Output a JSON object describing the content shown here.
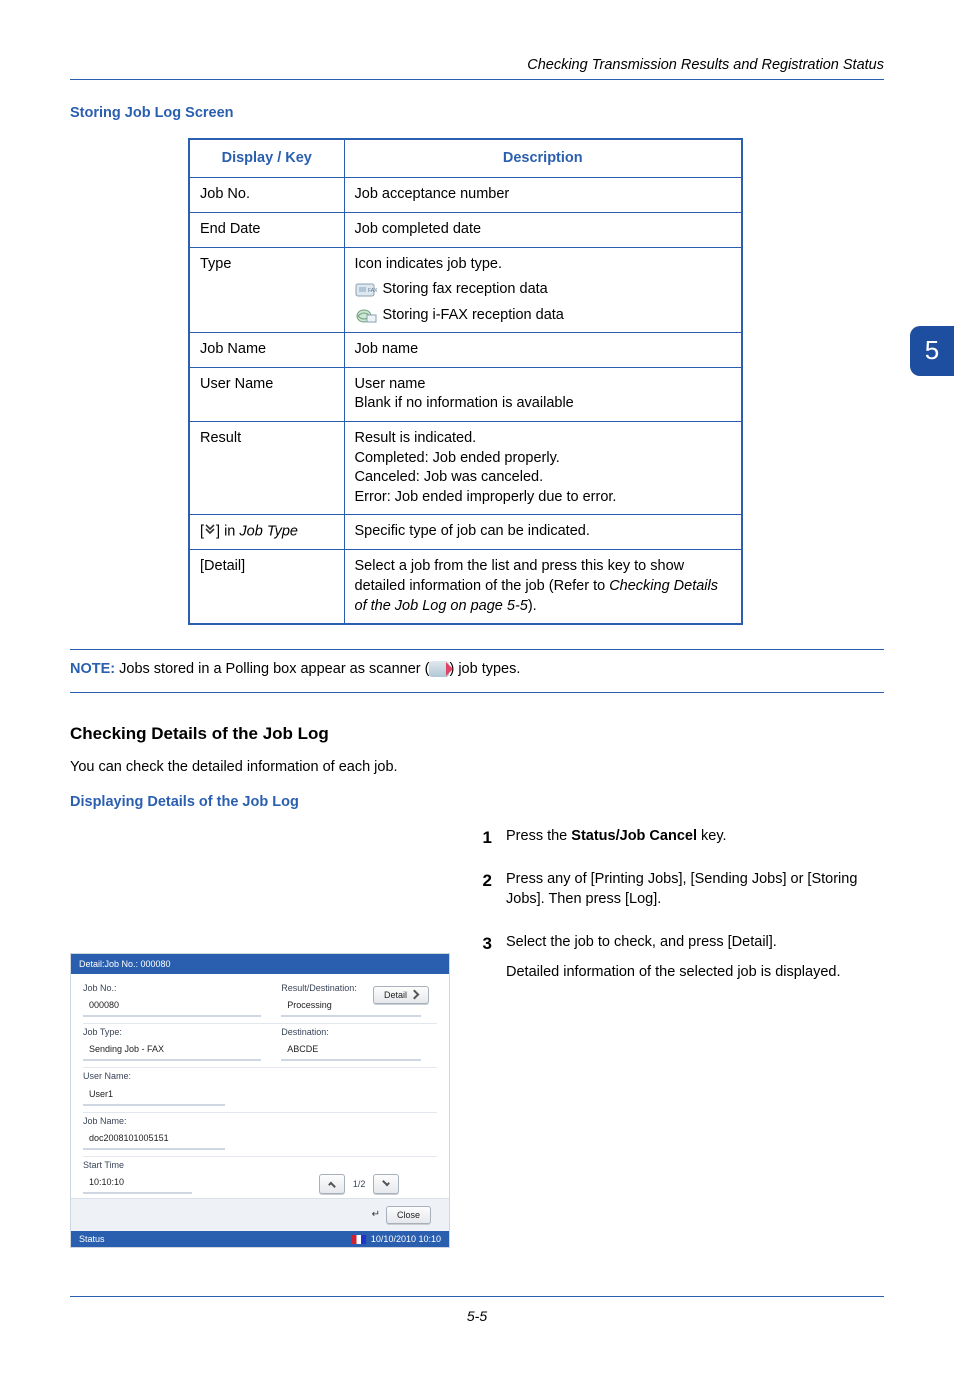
{
  "header": {
    "right": "Checking Transmission Results and Registration Status"
  },
  "section1": {
    "title": "Storing Job Log Screen"
  },
  "table": {
    "head": {
      "c1": "Display / Key",
      "c2": "Description"
    },
    "rows": [
      {
        "k": "Job No.",
        "v": "Job acceptance number"
      },
      {
        "k": "End Date",
        "v": "Job completed date"
      },
      {
        "k": "Type",
        "v_lines": {
          "l1": "Icon indicates job type.",
          "l2": " Storing fax reception data",
          "l3": "Storing i-FAX reception data"
        }
      },
      {
        "k": "Job Name",
        "v": "Job name"
      },
      {
        "k": "User Name",
        "v": "User name\nBlank if no information is available"
      },
      {
        "k": "Result",
        "v": "Result is indicated.\nCompleted: Job ended properly.\nCanceled: Job was canceled.\nError: Job ended improperly due to error."
      },
      {
        "k": "[     ] in Job Type",
        "k_icon_note": "down-chevrons",
        "v": "Specific type of job can be indicated."
      },
      {
        "k": "[Detail]",
        "v": "Select a job from the list and press this key to show detailed information of the job (Refer to Checking Details of the Job Log on page 5-5)."
      }
    ]
  },
  "note": {
    "label": "NOTE:",
    "text_before": " Jobs stored in a Polling box appear as scanner (",
    "text_after": ") job types."
  },
  "section2": {
    "title": "Checking Details of the Job Log",
    "intro": "You can check the detailed information of each job.",
    "sub": "Displaying Details of the Job Log"
  },
  "steps": {
    "s1": {
      "n": "1",
      "t1": "Press the ",
      "bold": "Status/Job Cancel",
      "t2": " key."
    },
    "s2": {
      "n": "2",
      "t": "Press any of [Printing Jobs], [Sending Jobs] or [Storing Jobs]. Then press [Log]."
    },
    "s3": {
      "n": "3",
      "t1": "Select the job to check, and press [Detail].",
      "t2": "Detailed information of the selected job is displayed."
    }
  },
  "ui": {
    "titlebar": "Detail:Job No.:        000080",
    "jobno_l": "Job No.:",
    "jobno_v": "000080",
    "result_l": "Result/Destination:",
    "result_v": "Processing",
    "detail_btn": "Detail",
    "jobtype_l": "Job Type:",
    "jobtype_v": "Sending Job - FAX",
    "dest_l": "Destination:",
    "dest_v": "ABCDE",
    "uname_l": "User Name:",
    "uname_v": "User1",
    "jname_l": "Job Name:",
    "jname_v": "doc2008101005151",
    "stime_l": "Start Time",
    "stime_v": "10:10:10",
    "page": "1/2",
    "close": "Close",
    "status_l": "Status",
    "status_r": "10/10/2010   10:10"
  },
  "badge": "5",
  "footer": "5-5"
}
